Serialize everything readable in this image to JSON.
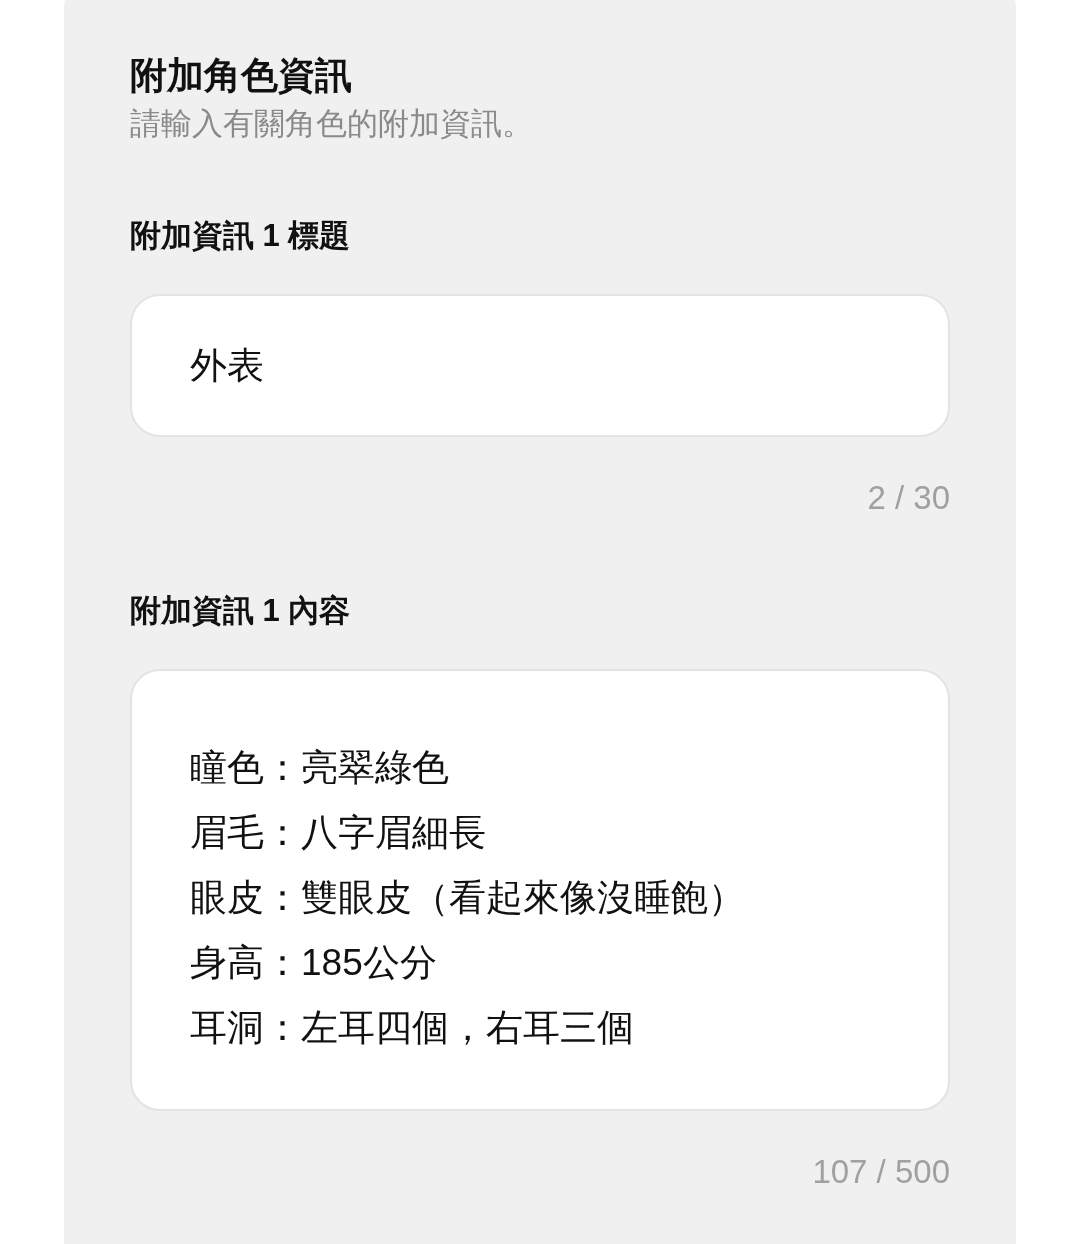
{
  "section": {
    "title": "附加角色資訊",
    "subtitle": "請輸入有關角色的附加資訊。"
  },
  "fields": [
    {
      "kind": "input",
      "label": "附加資訊 1 標題",
      "value": "外表",
      "counter": "2 / 30"
    },
    {
      "kind": "textarea",
      "label": "附加資訊 1 內容",
      "lines": [
        "瞳色：亮翠綠色",
        "眉毛：八字眉細長",
        "眼皮：雙眼皮（看起來像沒睡飽）",
        "身高：185公分",
        "耳洞：左耳四個，右耳三個"
      ],
      "counter": "107 / 500"
    }
  ]
}
